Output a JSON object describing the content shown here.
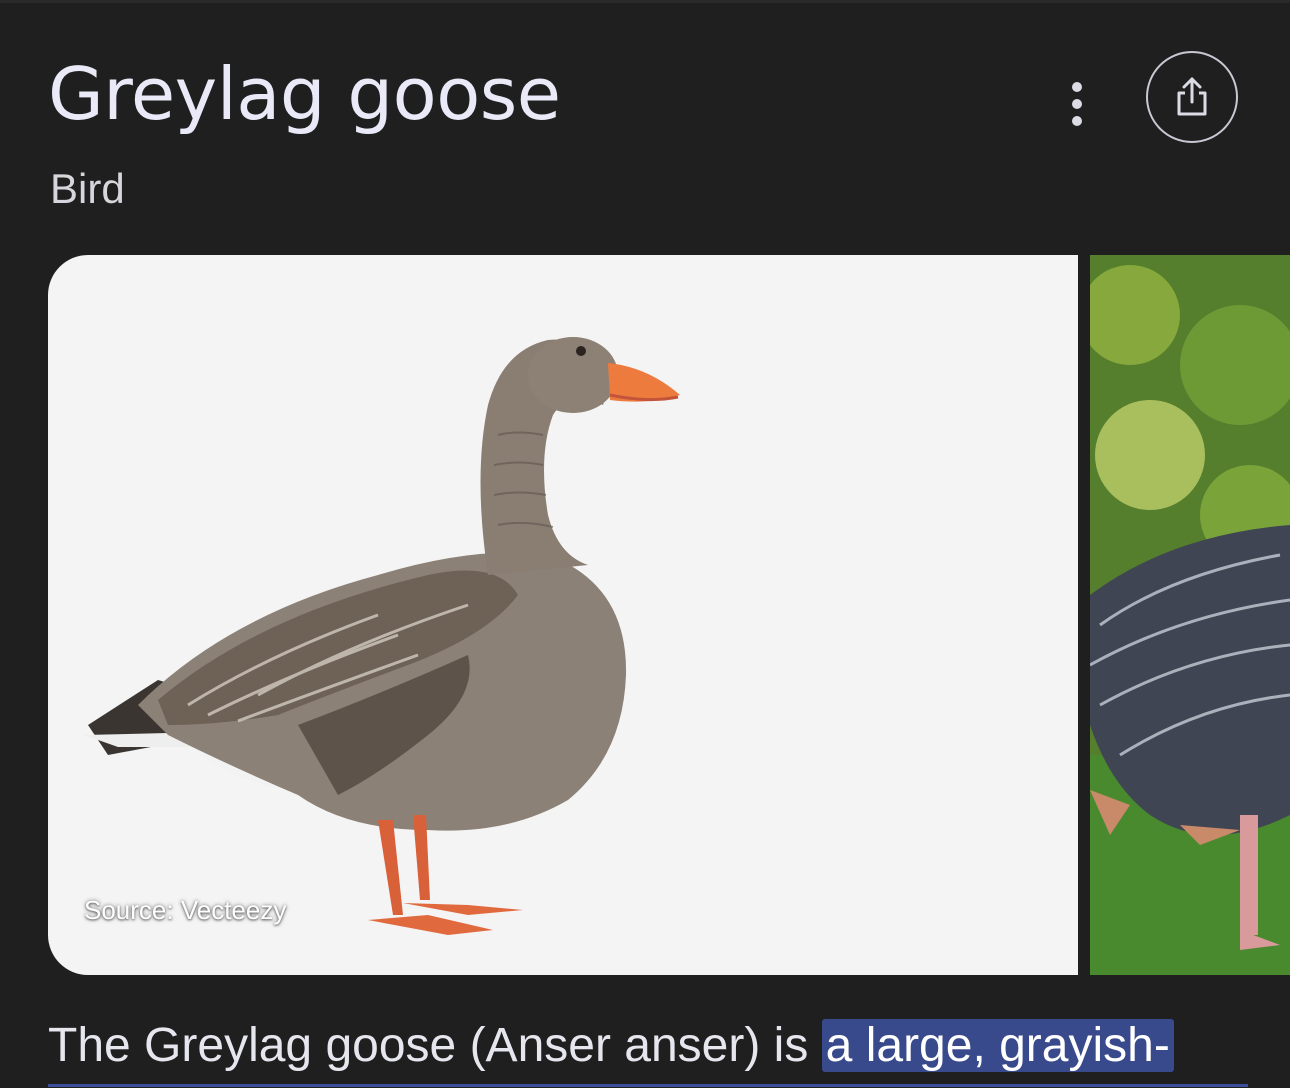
{
  "header": {
    "title": "Greylag goose",
    "subtitle": "Bird"
  },
  "actions": {
    "more_icon": "more-vert-icon",
    "share_icon": "share-icon"
  },
  "images": {
    "main_source": "Source: Vecteezy"
  },
  "description": {
    "text": "The Greylag goose (Anser anser) is ",
    "highlighted": "a large, grayish-"
  },
  "colors": {
    "background": "#1f1f1f",
    "title": "#e9e9f7",
    "highlight": "#394a8c"
  }
}
